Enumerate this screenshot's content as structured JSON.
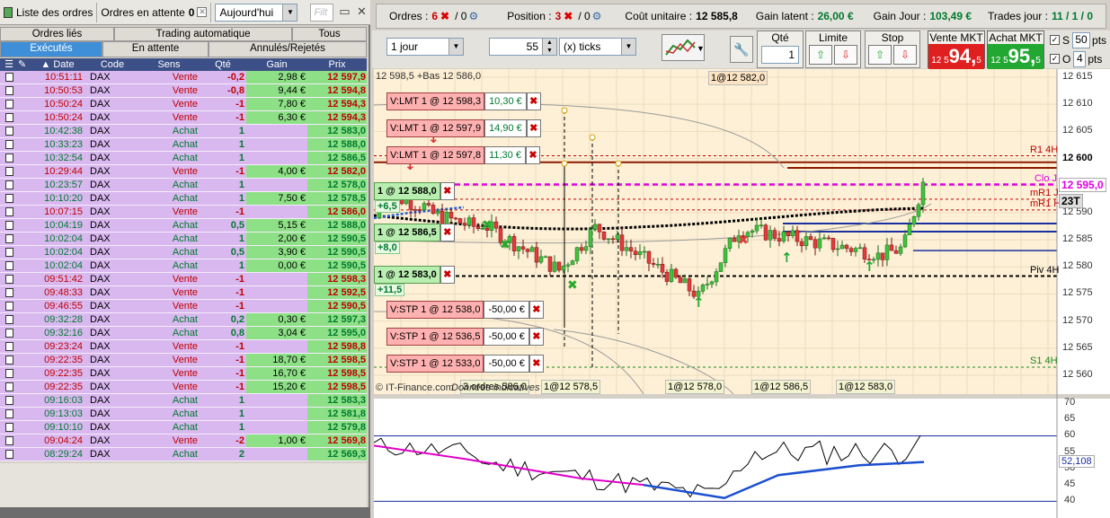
{
  "left_panel": {
    "title": "Liste des ordres",
    "pending_label": "Ordres en attente",
    "pending_count": "0",
    "period": "Aujourd'hui",
    "filter_placeholder": "Filt",
    "tabs_row1": [
      "Ordres liés",
      "Trading automatique",
      "Tous"
    ],
    "tabs_row2": [
      "Exécutés",
      "En attente",
      "Annulés/Rejetés"
    ],
    "columns": [
      "Date",
      "Code",
      "Sens",
      "Qté",
      "Gain",
      "Prix"
    ],
    "rows": [
      {
        "date": "10:51:11",
        "code": "DAX",
        "sens": "Vente",
        "qte": "-0,2",
        "gain": "2,98 €",
        "prix": "12 597,9"
      },
      {
        "date": "10:50:53",
        "code": "DAX",
        "sens": "Vente",
        "qte": "-0,8",
        "gain": "9,44 €",
        "prix": "12 594,8"
      },
      {
        "date": "10:50:24",
        "code": "DAX",
        "sens": "Vente",
        "qte": "-1",
        "gain": "7,80 €",
        "prix": "12 594,3"
      },
      {
        "date": "10:50:24",
        "code": "DAX",
        "sens": "Vente",
        "qte": "-1",
        "gain": "6,30 €",
        "prix": "12 594,3"
      },
      {
        "date": "10:42:38",
        "code": "DAX",
        "sens": "Achat",
        "qte": "1",
        "gain": "",
        "prix": "12 583,0"
      },
      {
        "date": "10:33:23",
        "code": "DAX",
        "sens": "Achat",
        "qte": "1",
        "gain": "",
        "prix": "12 588,0"
      },
      {
        "date": "10:32:54",
        "code": "DAX",
        "sens": "Achat",
        "qte": "1",
        "gain": "",
        "prix": "12 586,5"
      },
      {
        "date": "10:29:44",
        "code": "DAX",
        "sens": "Vente",
        "qte": "-1",
        "gain": "4,00 €",
        "prix": "12 582,0"
      },
      {
        "date": "10:23:57",
        "code": "DAX",
        "sens": "Achat",
        "qte": "1",
        "gain": "",
        "prix": "12 578,0"
      },
      {
        "date": "10:10:20",
        "code": "DAX",
        "sens": "Achat",
        "qte": "1",
        "gain": "7,50 €",
        "prix": "12 578,5"
      },
      {
        "date": "10:07:15",
        "code": "DAX",
        "sens": "Vente",
        "qte": "-1",
        "gain": "",
        "prix": "12 586,0"
      },
      {
        "date": "10:04:19",
        "code": "DAX",
        "sens": "Achat",
        "qte": "0,5",
        "gain": "5,15 €",
        "prix": "12 588,0"
      },
      {
        "date": "10:02:04",
        "code": "DAX",
        "sens": "Achat",
        "qte": "1",
        "gain": "2,00 €",
        "prix": "12 590,5"
      },
      {
        "date": "10:02:04",
        "code": "DAX",
        "sens": "Achat",
        "qte": "0,5",
        "gain": "3,90 €",
        "prix": "12 590,5"
      },
      {
        "date": "10:02:04",
        "code": "DAX",
        "sens": "Achat",
        "qte": "1",
        "gain": "0,00 €",
        "prix": "12 590,5"
      },
      {
        "date": "09:51:42",
        "code": "DAX",
        "sens": "Vente",
        "qte": "-1",
        "gain": "",
        "prix": "12 598,3"
      },
      {
        "date": "09:48:33",
        "code": "DAX",
        "sens": "Vente",
        "qte": "-1",
        "gain": "",
        "prix": "12 592,5"
      },
      {
        "date": "09:46:55",
        "code": "DAX",
        "sens": "Vente",
        "qte": "-1",
        "gain": "",
        "prix": "12 590,5"
      },
      {
        "date": "09:32:28",
        "code": "DAX",
        "sens": "Achat",
        "qte": "0,2",
        "gain": "0,30 €",
        "prix": "12 597,3"
      },
      {
        "date": "09:32:16",
        "code": "DAX",
        "sens": "Achat",
        "qte": "0,8",
        "gain": "3,04 €",
        "prix": "12 595,0"
      },
      {
        "date": "09:23:24",
        "code": "DAX",
        "sens": "Vente",
        "qte": "-1",
        "gain": "",
        "prix": "12 598,8"
      },
      {
        "date": "09:22:35",
        "code": "DAX",
        "sens": "Vente",
        "qte": "-1",
        "gain": "18,70 €",
        "prix": "12 598,5"
      },
      {
        "date": "09:22:35",
        "code": "DAX",
        "sens": "Vente",
        "qte": "-1",
        "gain": "16,70 €",
        "prix": "12 598,5"
      },
      {
        "date": "09:22:35",
        "code": "DAX",
        "sens": "Vente",
        "qte": "-1",
        "gain": "15,20 €",
        "prix": "12 598,5"
      },
      {
        "date": "09:16:03",
        "code": "DAX",
        "sens": "Achat",
        "qte": "1",
        "gain": "",
        "prix": "12 583,3"
      },
      {
        "date": "09:13:03",
        "code": "DAX",
        "sens": "Achat",
        "qte": "1",
        "gain": "",
        "prix": "12 581,8"
      },
      {
        "date": "09:10:10",
        "code": "DAX",
        "sens": "Achat",
        "qte": "1",
        "gain": "",
        "prix": "12 579,8"
      },
      {
        "date": "09:04:24",
        "code": "DAX",
        "sens": "Vente",
        "qte": "-2",
        "gain": "1,00 €",
        "prix": "12 569,8"
      },
      {
        "date": "08:29:24",
        "code": "DAX",
        "sens": "Achat",
        "qte": "2",
        "gain": "",
        "prix": "12 569,3"
      }
    ]
  },
  "summary": {
    "ordres_label": "Ordres :",
    "ordres_value": "6",
    "ordres_slash": "/ 0",
    "position_label": "Position :",
    "position_value": "3",
    "position_slash": "/ 0",
    "cout_label": "Coût unitaire :",
    "cout_value": "12 585,8",
    "gain_latent_label": "Gain latent :",
    "gain_latent_value": "26,00 €",
    "gain_jour_label": "Gain Jour :",
    "gain_jour_value": "103,49 €",
    "trades_label": "Trades jour :",
    "trades_value": "11 / 1 / 0"
  },
  "toolbar": {
    "period": "1 jour",
    "ticks_value": "55",
    "ticks_unit": "(x) ticks",
    "qte_label": "Qté",
    "qte_value": "1",
    "limite_label": "Limite",
    "stop_label": "Stop",
    "vente_label": "Vente MKT",
    "vente_prefix": "12 5",
    "vente_main": "94,",
    "vente_suffix": "5",
    "achat_label": "Achat MKT",
    "achat_prefix": "12 5",
    "achat_main": "95,",
    "achat_suffix": "5",
    "s_label": "S",
    "s_value": "50",
    "o_label": "O",
    "o_value": "4",
    "pts_label": "pts"
  },
  "chart": {
    "header_text": "12 598,5 +Bas 12 586,0",
    "top_pill": "1@12 582,0",
    "y_ticks": [
      "12 615",
      "12 610",
      "12 605",
      "12 600",
      "12 595",
      "12 590",
      "12 585",
      "12 580",
      "12 575",
      "12 570",
      "12 565",
      "12 560"
    ],
    "level_labels": [
      "R1 4H",
      "Clo J",
      "mR1 J",
      "mR1 H",
      "Piv 4H",
      "S1 4H"
    ],
    "price_tag": "12 595,0",
    "tick_count": "23T",
    "pending_orders": [
      {
        "text": "V:LMT  1 @ 12 598,3",
        "value": "10,30 €",
        "type": "lmt"
      },
      {
        "text": "V:LMT  1 @ 12 597,9",
        "value": "14,90 €",
        "type": "lmt"
      },
      {
        "text": "V:LMT  1 @ 12 597,8",
        "value": "11,30 €",
        "type": "lmt"
      },
      {
        "text": "V:STP  1 @ 12 538,0",
        "value": "-50,00 €",
        "type": "stp"
      },
      {
        "text": "V:STP  1 @ 12 536,5",
        "value": "-50,00 €",
        "type": "stp"
      },
      {
        "text": "V:STP  1 @ 12 533,0",
        "value": "-50,00 €",
        "type": "stp"
      }
    ],
    "positions": [
      {
        "text": "1 @ 12 588,0",
        "gain": "+6,5"
      },
      {
        "text": "1 @ 12 586,5",
        "gain": "+8,0"
      },
      {
        "text": "1 @ 12 583,0",
        "gain": "+11,5"
      }
    ],
    "bottom_pills": [
      "3 ordres 586,0",
      "1@12 578,5",
      "1@12 578,0",
      "1@12 586,5",
      "1@12 583,0"
    ],
    "footer_brand": "© IT-Finance.com",
    "footer_note": "Données indicatives",
    "osc_ticks": [
      "70",
      "65",
      "60",
      "55",
      "50",
      "45",
      "40"
    ],
    "osc_value": "52,108"
  },
  "colors": {
    "purple_row": "#d9b8f0",
    "green_cell": "#8ee087",
    "header_blue": "#3c4f86",
    "tab_active": "#3f8fd8",
    "sell_red": "#e02020",
    "buy_green": "#22a832"
  }
}
